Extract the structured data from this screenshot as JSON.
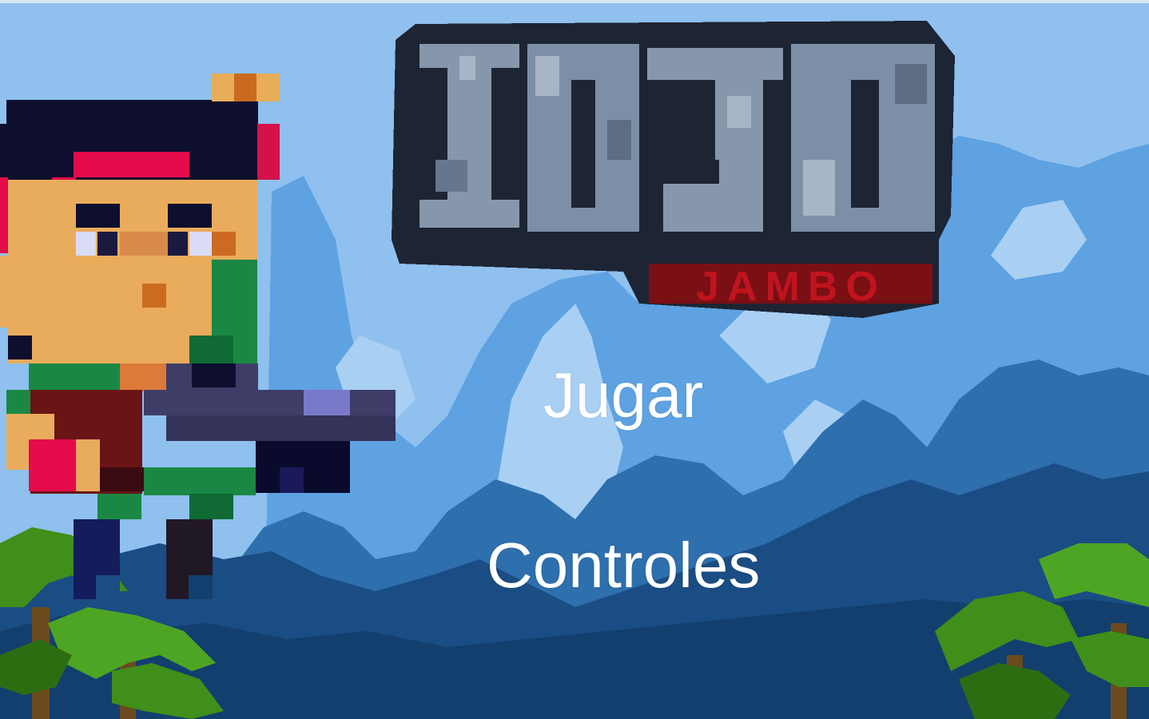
{
  "menu": {
    "play_label": "Jugar",
    "controls_label": "Controles"
  },
  "logo": {
    "title": "IOJO",
    "subtitle": "JAMBO"
  },
  "colors": {
    "sky": "#8fc0ee",
    "sky_light": "#a9d0f3",
    "jungle_dark": "#123f6e",
    "jungle_mid": "#1f5e96",
    "palm_green": "#3f8f1a",
    "logo_stone": "#7c8fa6",
    "logo_red": "#c0141e",
    "menu_text": "#ffffff"
  },
  "icons": {
    "character": "pixel-hero-with-gun-icon",
    "logo": "game-logo"
  }
}
